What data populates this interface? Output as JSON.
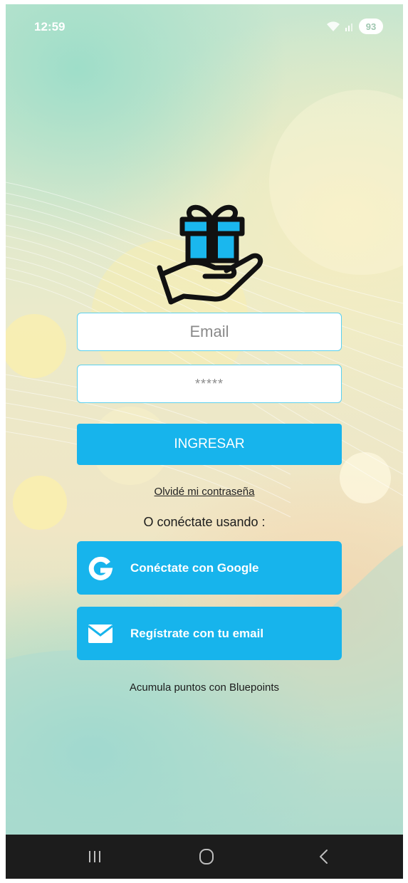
{
  "status_bar": {
    "time": "12:59",
    "battery": "93",
    "icons": [
      "wifi-icon",
      "signal-icon",
      "battery-icon"
    ]
  },
  "logo": {
    "icon": "gift-in-hand-icon",
    "colors": {
      "gift": "#1ab7ee",
      "outline": "#111111"
    }
  },
  "login": {
    "email_placeholder": "Email",
    "password_placeholder": "*****",
    "submit_label": "INGRESAR",
    "forgot_label": "Olvidé mi contraseña",
    "connect_using": "O conéctate usando :"
  },
  "social": {
    "google": {
      "icon": "google-g-icon",
      "label": "Conéctate con Google"
    },
    "email": {
      "icon": "envelope-icon",
      "label": "Regístrate con tu email"
    }
  },
  "footer": {
    "text": "Acumula puntos con Bluepoints"
  },
  "nav_bar": {
    "items": [
      "recents-icon",
      "home-icon",
      "back-icon"
    ]
  },
  "colors": {
    "accent": "#17b4ec",
    "input_border": "#5ad0ee",
    "nav_bar": "#1c1c1c"
  }
}
